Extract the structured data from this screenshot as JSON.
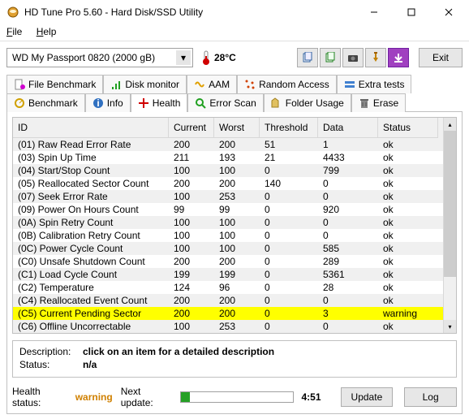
{
  "window": {
    "title": "HD Tune Pro 5.60 - Hard Disk/SSD Utility"
  },
  "menu": {
    "file": "File",
    "help": "Help"
  },
  "toolbar": {
    "drive": "WD    My Passport 0820 (2000 gB)",
    "temp": "28°C",
    "exit": "Exit"
  },
  "tabsRow1": [
    {
      "label": "File Benchmark"
    },
    {
      "label": "Disk monitor"
    },
    {
      "label": "AAM"
    },
    {
      "label": "Random Access"
    },
    {
      "label": "Extra tests"
    }
  ],
  "tabsRow2": [
    {
      "label": "Benchmark"
    },
    {
      "label": "Info"
    },
    {
      "label": "Health"
    },
    {
      "label": "Error Scan"
    },
    {
      "label": "Folder Usage"
    },
    {
      "label": "Erase"
    }
  ],
  "columns": {
    "id": "ID",
    "current": "Current",
    "worst": "Worst",
    "threshold": "Threshold",
    "data": "Data",
    "status": "Status"
  },
  "rows": [
    {
      "id": "(01) Raw Read Error Rate",
      "cur": "200",
      "wor": "200",
      "thr": "51",
      "dat": "1",
      "sta": "ok",
      "cls": "alt"
    },
    {
      "id": "(03) Spin Up Time",
      "cur": "211",
      "wor": "193",
      "thr": "21",
      "dat": "4433",
      "sta": "ok",
      "cls": "norm"
    },
    {
      "id": "(04) Start/Stop Count",
      "cur": "100",
      "wor": "100",
      "thr": "0",
      "dat": "799",
      "sta": "ok",
      "cls": "alt"
    },
    {
      "id": "(05) Reallocated Sector Count",
      "cur": "200",
      "wor": "200",
      "thr": "140",
      "dat": "0",
      "sta": "ok",
      "cls": "norm"
    },
    {
      "id": "(07) Seek Error Rate",
      "cur": "100",
      "wor": "253",
      "thr": "0",
      "dat": "0",
      "sta": "ok",
      "cls": "alt"
    },
    {
      "id": "(09) Power On Hours Count",
      "cur": "99",
      "wor": "99",
      "thr": "0",
      "dat": "920",
      "sta": "ok",
      "cls": "norm"
    },
    {
      "id": "(0A) Spin Retry Count",
      "cur": "100",
      "wor": "100",
      "thr": "0",
      "dat": "0",
      "sta": "ok",
      "cls": "alt"
    },
    {
      "id": "(0B) Calibration Retry Count",
      "cur": "100",
      "wor": "100",
      "thr": "0",
      "dat": "0",
      "sta": "ok",
      "cls": "norm"
    },
    {
      "id": "(0C) Power Cycle Count",
      "cur": "100",
      "wor": "100",
      "thr": "0",
      "dat": "585",
      "sta": "ok",
      "cls": "alt"
    },
    {
      "id": "(C0) Unsafe Shutdown Count",
      "cur": "200",
      "wor": "200",
      "thr": "0",
      "dat": "289",
      "sta": "ok",
      "cls": "norm"
    },
    {
      "id": "(C1) Load Cycle Count",
      "cur": "199",
      "wor": "199",
      "thr": "0",
      "dat": "5361",
      "sta": "ok",
      "cls": "alt"
    },
    {
      "id": "(C2) Temperature",
      "cur": "124",
      "wor": "96",
      "thr": "0",
      "dat": "28",
      "sta": "ok",
      "cls": "norm"
    },
    {
      "id": "(C4) Reallocated Event Count",
      "cur": "200",
      "wor": "200",
      "thr": "0",
      "dat": "0",
      "sta": "ok",
      "cls": "alt"
    },
    {
      "id": "(C5) Current Pending Sector",
      "cur": "200",
      "wor": "200",
      "thr": "0",
      "dat": "3",
      "sta": "warning",
      "cls": "warn"
    },
    {
      "id": "(C6) Offline Uncorrectable",
      "cur": "100",
      "wor": "253",
      "thr": "0",
      "dat": "0",
      "sta": "ok",
      "cls": "alt"
    }
  ],
  "detail": {
    "descLabel": "Description:",
    "descValue": "click on an item for a detailed description",
    "statusLabel": "Status:",
    "statusValue": "n/a"
  },
  "footer": {
    "healthLabel": "Health status:",
    "healthValue": "warning",
    "nextLabel": "Next update:",
    "timer": "4:51",
    "update": "Update",
    "log": "Log"
  }
}
